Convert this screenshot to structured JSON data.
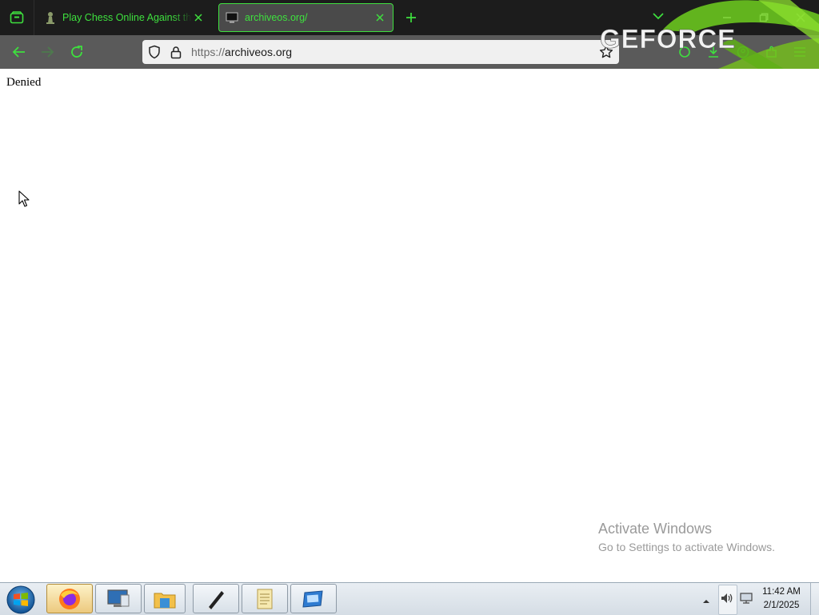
{
  "browser": {
    "tabs": [
      {
        "title": "Play Chess Online Against the Computer",
        "active": false,
        "icon": "chess-pawn-icon"
      },
      {
        "title": "archiveos.org/",
        "active": true,
        "icon": "monitor-icon"
      }
    ],
    "url": {
      "protocol": "https://",
      "host": "archiveos.org"
    },
    "accent_color": "#3ee03e"
  },
  "overlay": {
    "brand": "GEFORCE"
  },
  "page": {
    "body_text": "Denied"
  },
  "watermark": {
    "title": "Activate Windows",
    "subtitle": "Go to Settings to activate Windows."
  },
  "taskbar": {
    "apps": [
      "firefox-icon",
      "remote-desktop-icon",
      "file-explorer-icon",
      "pen-app-icon",
      "notes-icon",
      "window-app-icon"
    ],
    "clock": {
      "time": "11:42 AM",
      "date": "2/1/2025"
    }
  }
}
